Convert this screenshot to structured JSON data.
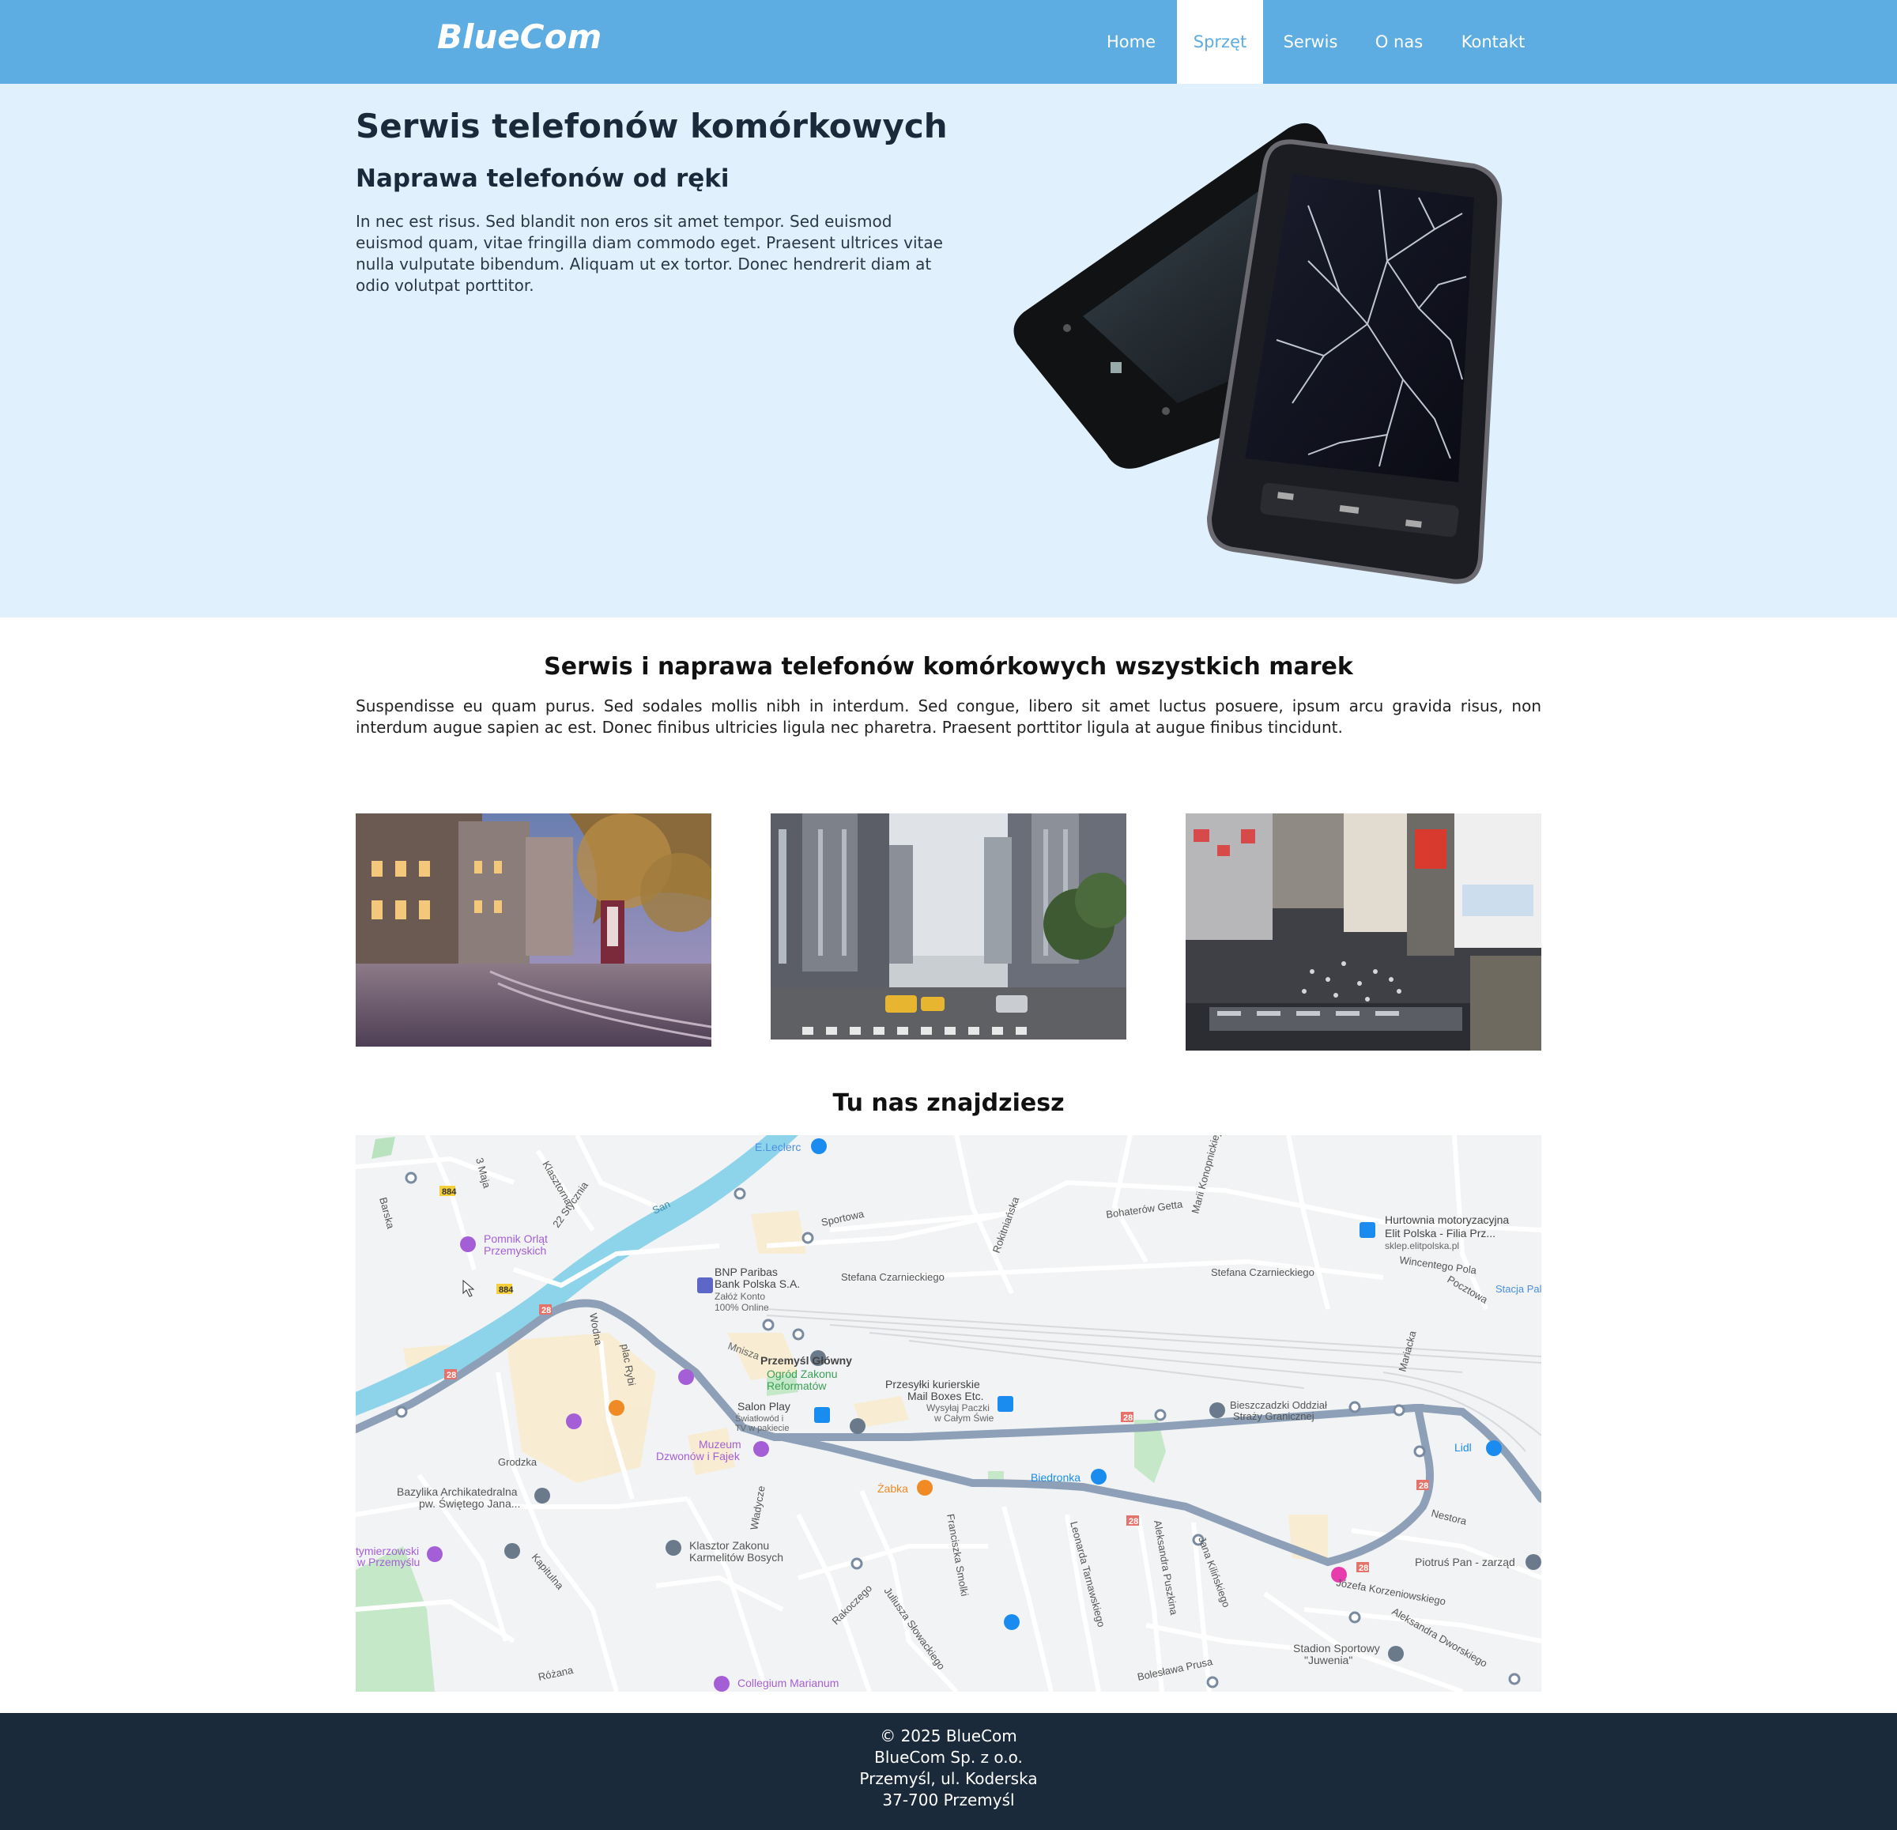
{
  "header": {
    "logo": "BlueCom",
    "nav": [
      {
        "label": "Home"
      },
      {
        "label": "Sprzęt"
      },
      {
        "label": "Serwis"
      },
      {
        "label": "O nas"
      },
      {
        "label": "Kontakt"
      }
    ],
    "active_nav": "Sprzęt",
    "colors": {
      "bar": "#5dade2",
      "hero_bg": "#e1f0fd",
      "footer_bg": "#1b2a3a"
    }
  },
  "hero": {
    "title": "Serwis telefonów komórkowych",
    "subtitle": "Naprawa telefonów od ręki",
    "text": "In nec est risus. Sed blandit non eros sit amet tempor. Sed euismod euismod quam, vitae fringilla diam commodo eget. Praesent ultrices vitae nulla vulputate bibendum. Aliquam ut ex tortor. Donec hendrerit diam at odio volutpat porttitor."
  },
  "section": {
    "title": "Serwis i naprawa telefonów komórkowych wszystkich marek",
    "text": "Suspendisse eu quam purus. Sed sodales mollis nibh in interdum. Sed congue, libero sit amet luctus posuere, ipsum arcu gravida risus, non interdum augue sapien ac est. Donec finibus ultricies ligula nec pharetra. Praesent porttitor ligula at augue finibus tincidunt."
  },
  "map": {
    "title": "Tu nas znajdziesz",
    "labels": {
      "eleclerc": "E.Leclerc",
      "sportowa": "Sportowa",
      "bohaterow": "Bohaterów Getta",
      "hurtownia1": "Hurtownia motoryzacyjna",
      "hurtownia2": "Elit Polska - Filia Prz...",
      "hurtownia3": "sklep.elitpolska.pl",
      "wincentego": "Wincentego Pola",
      "pocztowa": "Pocztowa",
      "stacja": "Stacja Paliw",
      "pomnik1": "Pomnik Orląt",
      "pomnik2": "Przemyskich",
      "bnp1": "BNP Paribas",
      "bnp2": "Bank Polska S.A.",
      "bnp3": "Załóż Konto",
      "bnp4": "100% Online",
      "czarnieckiego1": "Stefana Czarnieckiego",
      "czarnieckiego2": "Stefana Czarnieckiego",
      "san": "San",
      "mnisza": "Mnisza",
      "dworzec": "Przemyśl Główny",
      "ogrod1": "Ogród Zakonu",
      "ogrod2": "Reformatów",
      "przesylki1": "Przesyłki kurierskie",
      "przesylki2": "Mail Boxes Etc.",
      "przesylki3": "Wysyłaj Paczki",
      "przesylki4": "w Całym Świe",
      "salon1": "Salon Play",
      "salon2": "Światłowód i",
      "salon3": "TV w pakiecie",
      "bieszczadzki1": "Bieszczadzki Oddział",
      "bieszczadzki2": "Straży Granicznej",
      "muzeum1": "Muzeum",
      "muzeum2": "Dzwonów i Fajek",
      "grodzka": "Grodzka",
      "bazylika1": "Bazylika Archikatedralna",
      "bazylika2": "pw. Świętego Jana...",
      "zabka": "Żabka",
      "biedronka": "Biedronka",
      "lidl": "Lidl",
      "nestora": "Nestora",
      "piotrus": "Piotruś Pan - zarząd",
      "korzeniowskiego": "Józefa Korzeniowskiego",
      "dworskiego": "Aleksandra Dworskiego",
      "stadion1": "Stadion Sportowy",
      "stadion2": "\"Juwenia\"",
      "boleslawa": "Bolesława Prusa",
      "klasztor1": "Klasztor Zakonu",
      "klasztor2": "Karmelitów Bosych",
      "tymierzowski1": "tymierzowski",
      "tymierzowski2": "w Przemyślu",
      "collegium": "Collegium Marianum",
      "rozana": "Różana",
      "kapitulna": "Kapitulna",
      "wodna": "Wodna",
      "placrybi": "plac Rybi",
      "barska": "Barska",
      "trzeciego": "3 Maja",
      "klasztorna": "Klasztorna",
      "styczna": "22 Stycznia",
      "rokitianska": "Rokitniańska",
      "mariikon": "Marii Konopnickiej",
      "mariacka": "Mariacka",
      "slowackiego": "Juliusza Słowackiego",
      "smolki": "Franciszka Smolki",
      "tarnawskiego": "Leonarda Tarnawskiego",
      "puszkina": "Aleksandra Puszkina",
      "kilinskiego": "Jana Kilińskiego",
      "rakoczego": "Rakoczego",
      "wladycze": "Władycze",
      "road884a": "884",
      "road884b": "884",
      "road28a": "28",
      "road28b": "28",
      "road28c": "28",
      "road28d": "28",
      "road28e": "28",
      "road28f": "28"
    }
  },
  "footer": {
    "copyright": "© 2025 BlueCom",
    "company": "BlueCom Sp. z o.o.",
    "address": "Przemyśl, ul. Koderska",
    "postal": "37-700 Przemyśl"
  }
}
